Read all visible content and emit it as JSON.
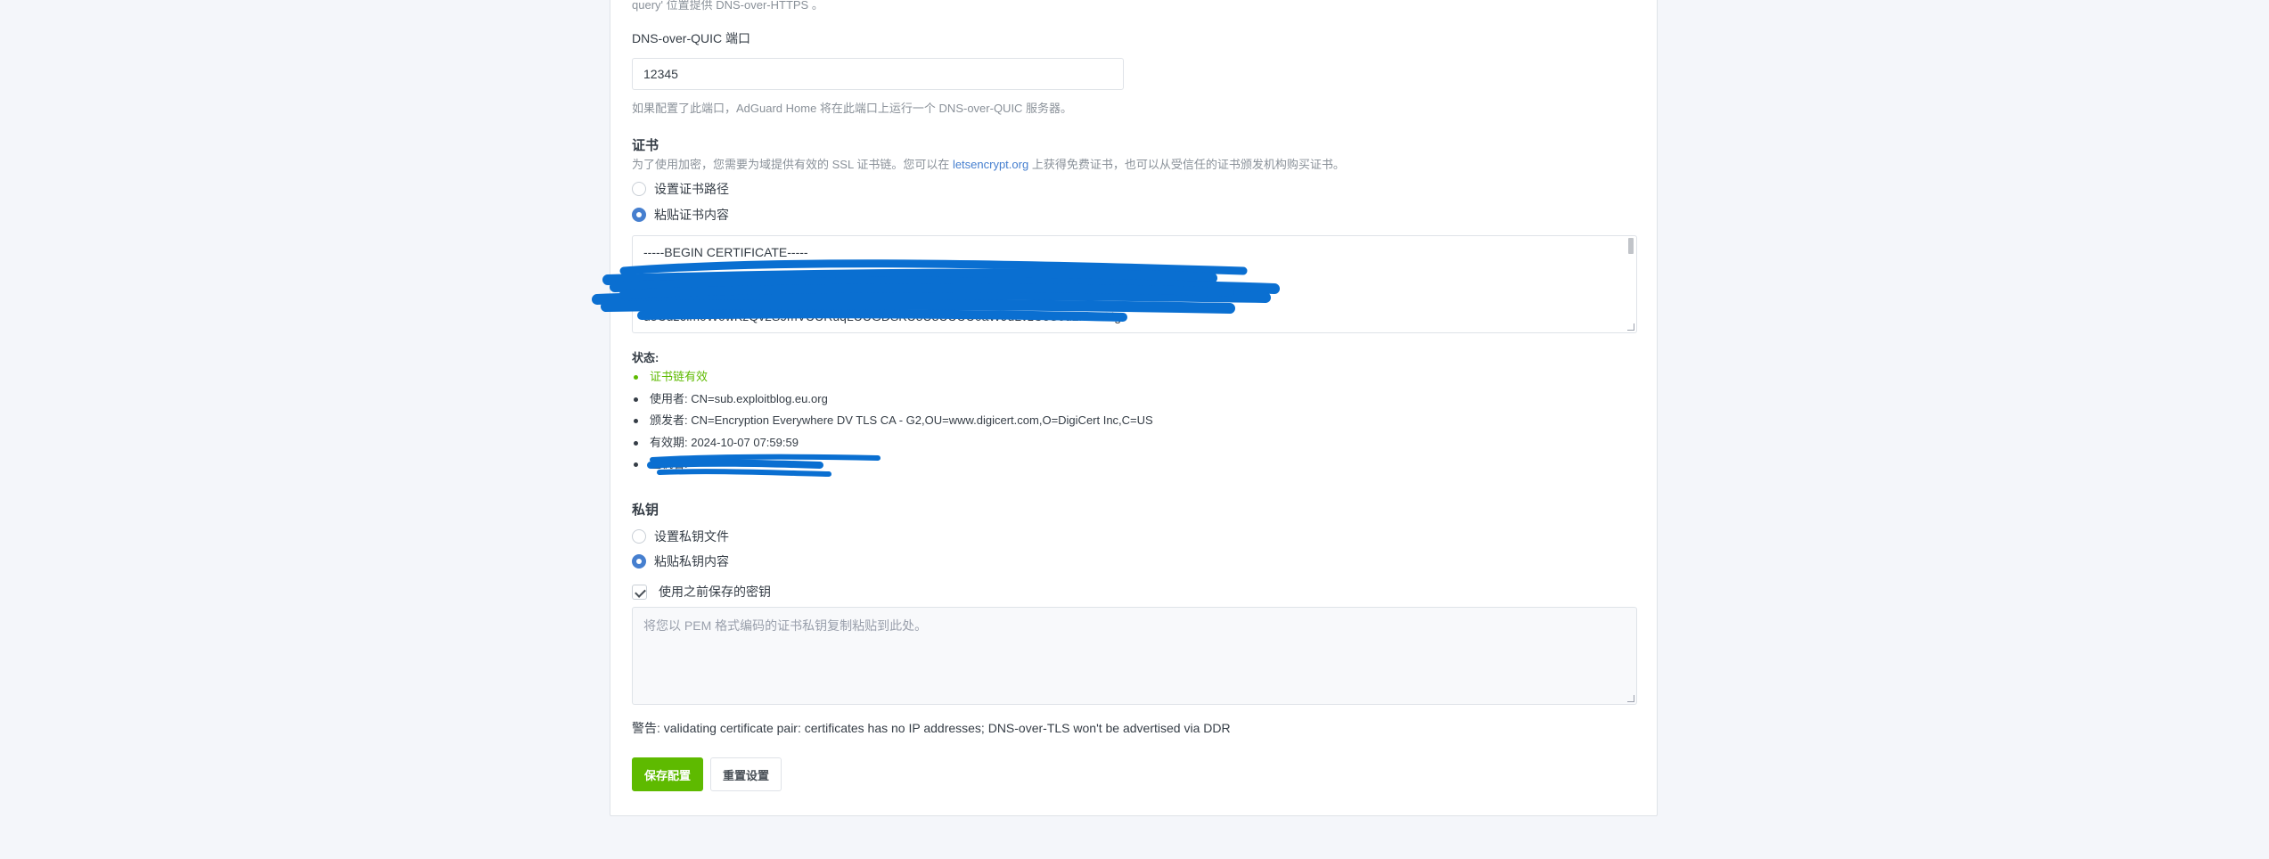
{
  "doq": {
    "top_note": "query' 位置提供 DNS-over-HTTPS 。",
    "label": "DNS-over-QUIC 端口",
    "value": "12345",
    "hint": "如果配置了此端口，AdGuard Home 将在此端口上运行一个 DNS-over-QUIC 服务器。"
  },
  "certificate": {
    "heading": "证书",
    "desc_before": "为了使用加密，您需要为域提供有效的 SSL 证书链。您可以在 ",
    "desc_link": "letsencrypt.org",
    "desc_after": " 上获得免费证书，也可以从受信任的证书颁发机构购买证书。",
    "option_path": "设置证书路径",
    "option_paste": "粘贴证书内容",
    "content_first": "-----BEGIN CERTIFICATE-----",
    "content_last": "u5Cuz6lm0W0wKzQv2S9mVUURuqLUUGDSKU5U3UUUU0aW9uLvzU5S5d2hlcmUg"
  },
  "status": {
    "label": "状态:",
    "items": [
      "证书链有效",
      "使用者: CN=sub.exploitblog.eu.org",
      "颁发者: CN=Encryption Everywhere DV TLS CA - G2,OU=www.digicert.com,O=DigiCert Inc,C=US",
      "有效期: 2024-10-07 07:59:59",
      "主机名:"
    ]
  },
  "private_key": {
    "heading": "私钥",
    "option_file": "设置私钥文件",
    "option_paste": "粘贴私钥内容",
    "use_saved": "使用之前保存的密钥",
    "placeholder": "将您以 PEM 格式编码的证书私钥复制粘贴到此处。"
  },
  "warning": "警告: validating certificate pair: certificates has no IP addresses; DNS-over-TLS won't be advertised via DDR",
  "buttons": {
    "save": "保存配置",
    "reset": "重置设置"
  },
  "colors": {
    "accent": "#467fcf",
    "success": "#5eba00",
    "redaction": "#0a6fd1"
  }
}
